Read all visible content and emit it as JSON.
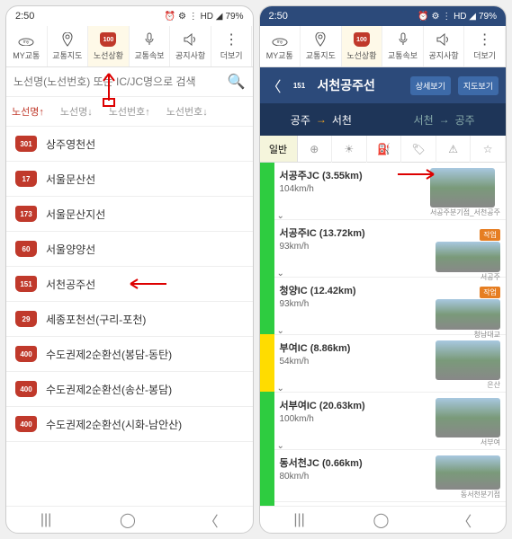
{
  "status": {
    "time": "2:50",
    "battery": "79%",
    "icons": "⏰ ⚙ ⋮ HD ◢"
  },
  "tabs": [
    {
      "label": "MY교통",
      "icon": "my"
    },
    {
      "label": "교통지도",
      "icon": "pin"
    },
    {
      "label": "노선상황",
      "icon": "100"
    },
    {
      "label": "교통속보",
      "icon": "mic"
    },
    {
      "label": "공지사항",
      "icon": "speaker"
    },
    {
      "label": "더보기",
      "icon": "more"
    }
  ],
  "search": {
    "placeholder": "노선명(노선번호) 또는 IC/JC명으로 검색"
  },
  "sort": {
    "name_asc": "노선명↑",
    "name_desc": "노선명↓",
    "num_asc": "노선번호↑",
    "num_desc": "노선번호↓"
  },
  "routes": [
    {
      "num": "301",
      "name": "상주영천선"
    },
    {
      "num": "17",
      "name": "서울문산선"
    },
    {
      "num": "173",
      "name": "서울문산지선"
    },
    {
      "num": "60",
      "name": "서울양양선"
    },
    {
      "num": "151",
      "name": "서천공주선"
    },
    {
      "num": "29",
      "name": "세종포천선(구리-포천)"
    },
    {
      "num": "400",
      "name": "수도권제2순환선(봉담-동탄)"
    },
    {
      "num": "400",
      "name": "수도권제2순환선(송산-봉담)"
    },
    {
      "num": "400",
      "name": "수도권제2순환선(시화-남안산)"
    }
  ],
  "detail": {
    "shield": "151",
    "title": "서천공주선",
    "btn_detail": "상세보기",
    "btn_map": "지도보기",
    "dir_a_from": "공주",
    "dir_a_to": "서천",
    "dir_b_from": "서천",
    "dir_b_to": "공주",
    "toolbar_label": "일반",
    "ics": [
      {
        "name": "서공주JC (3.55km)",
        "speed": "104km/h",
        "loc": "서공주분기점_서천공주",
        "badge": ""
      },
      {
        "name": "서공주IC (13.72km)",
        "speed": "93km/h",
        "loc": "서공주",
        "badge": "작업"
      },
      {
        "name": "청양IC (12.42km)",
        "speed": "93km/h",
        "loc": "청남대교",
        "badge": "작업"
      },
      {
        "name": "부여IC (8.86km)",
        "speed": "54km/h",
        "loc": "은산",
        "badge": ""
      },
      {
        "name": "서부여IC (20.63km)",
        "speed": "100km/h",
        "loc": "서부여",
        "badge": ""
      },
      {
        "name": "동서천JC (0.66km)",
        "speed": "80km/h",
        "loc": "동서천분기점",
        "badge": ""
      }
    ]
  }
}
